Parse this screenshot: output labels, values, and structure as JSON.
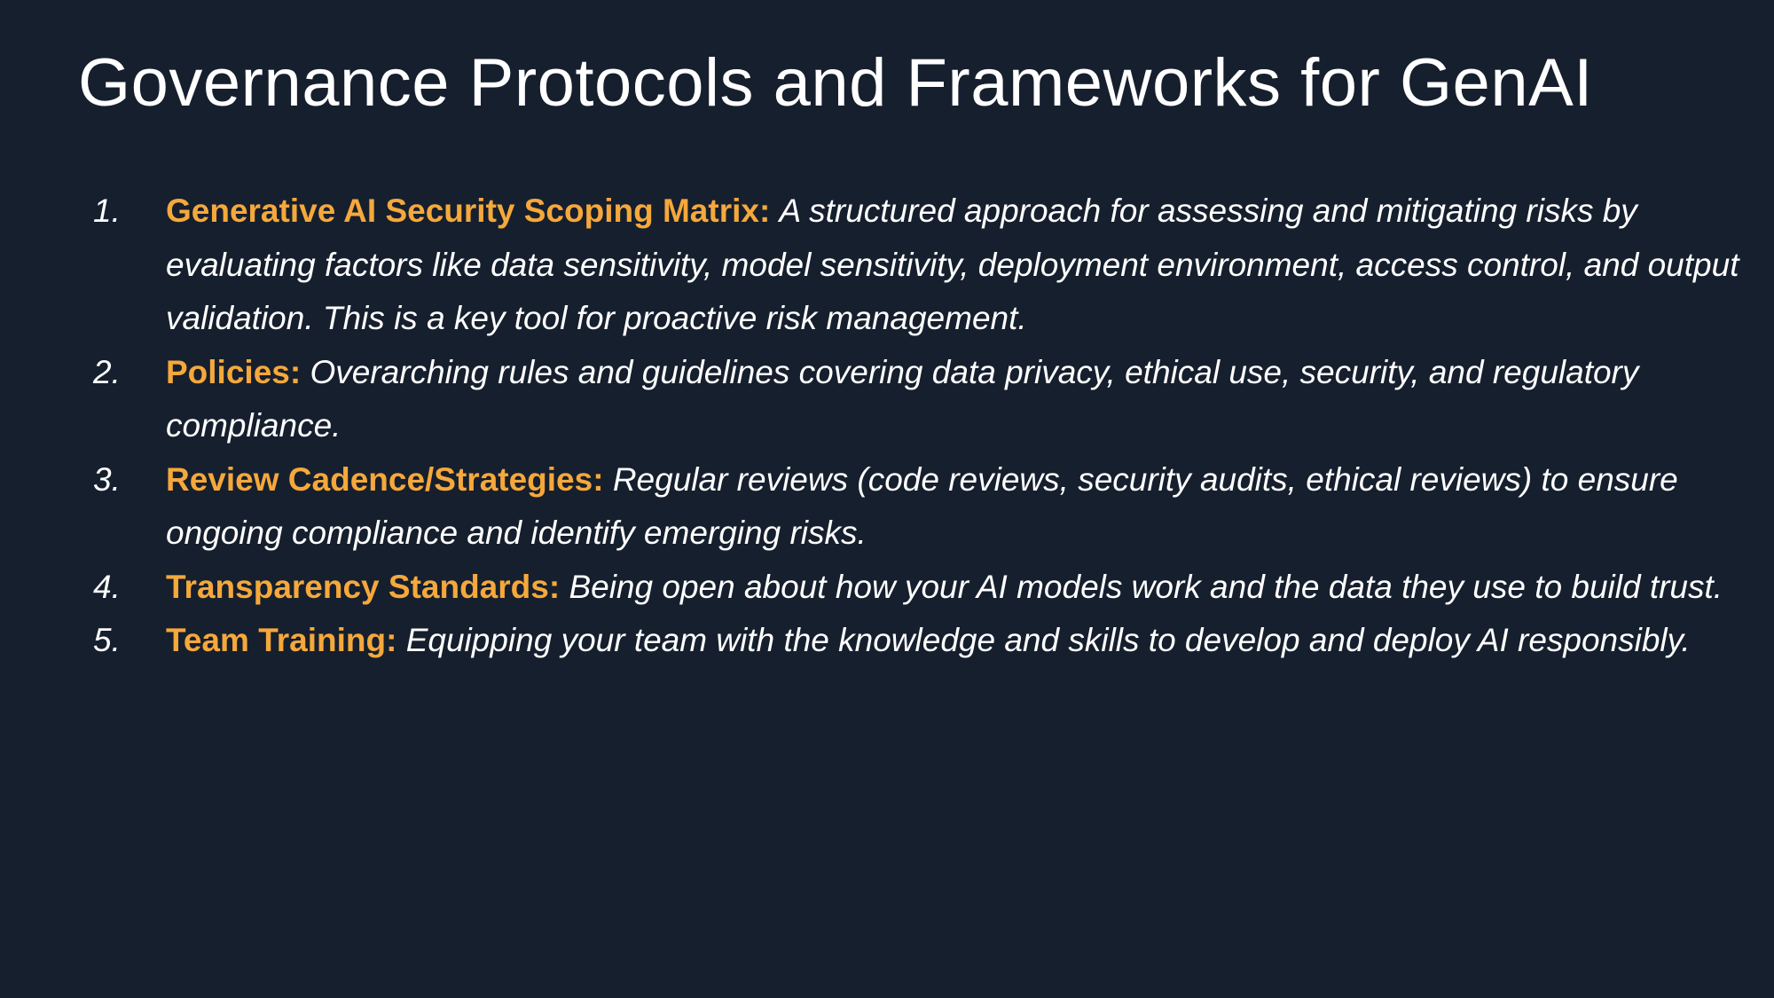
{
  "slide": {
    "title": "Governance Protocols and Frameworks for GenAI"
  },
  "items": [
    {
      "number": "1.",
      "term": "Generative AI Security Scoping Matrix:",
      "description": "A structured approach for assessing and mitigating risks by evaluating factors like data sensitivity, model sensitivity, deployment environment, access control, and output validation. This is a key tool for proactive risk management."
    },
    {
      "number": "2.",
      "term": "Policies:",
      "description": "Overarching rules and guidelines covering data privacy, ethical use, security, and regulatory compliance."
    },
    {
      "number": "3.",
      "term": "Review Cadence/Strategies:",
      "description": "Regular reviews (code reviews, security audits, ethical reviews) to ensure ongoing compliance and identify emerging risks."
    },
    {
      "number": "4.",
      "term": "Transparency Standards:",
      "description": "Being open about how your AI models work and the data they use to build trust."
    },
    {
      "number": "5.",
      "term": "Team Training:",
      "description": "Equipping your team with the knowledge and skills to develop and deploy AI responsibly."
    }
  ],
  "colors": {
    "background": "#161f2d",
    "accent": "#f5a83b",
    "text": "#ffffff"
  }
}
